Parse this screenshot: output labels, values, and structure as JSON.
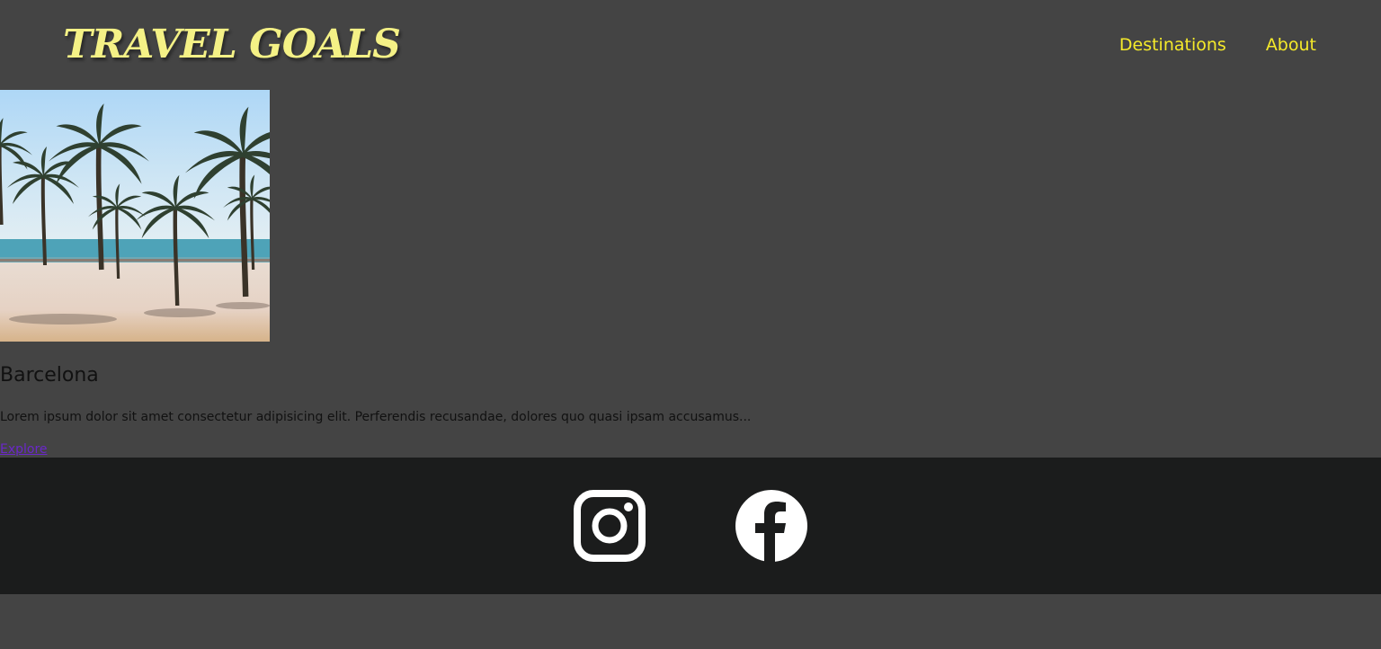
{
  "header": {
    "logo_text": "TRAVEL GOALS",
    "nav": [
      {
        "label": "Destinations"
      },
      {
        "label": "About"
      }
    ]
  },
  "card": {
    "image_icon": "beach-palm-trees-photo",
    "title": "Barcelona",
    "description": "Lorem ipsum dolor sit amet consectetur adipisicing elit. Perferendis recusandae, dolores quo quasi ipsam accusamus...",
    "link_label": "Explore"
  },
  "footer": {
    "social": [
      {
        "icon": "instagram-icon"
      },
      {
        "icon": "facebook-icon"
      }
    ]
  },
  "colors": {
    "page_background": "#444444",
    "logo": "#f4f186",
    "nav_link": "#f5ea2a",
    "footer_background": "#1b1c1c",
    "link": "#6a27c9",
    "text": "#111111"
  }
}
